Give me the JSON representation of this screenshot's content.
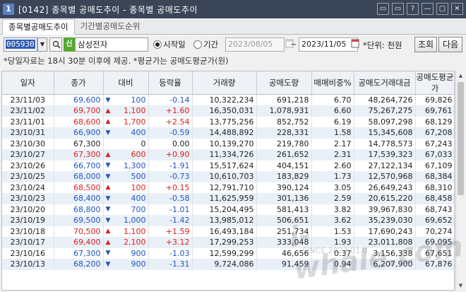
{
  "window": {
    "badge": "1",
    "title": "[0142] 종목별 공매도추이 - 종목별 공매도추이",
    "btns": [
      "▭",
      "▭",
      "?",
      "—",
      "▢",
      "✕"
    ]
  },
  "tabs": [
    {
      "label": "종목별공매도추이"
    },
    {
      "label": "기간별공매도순위"
    }
  ],
  "toolbar": {
    "code": "005930",
    "badge": "신",
    "stock_name": "삼성전자",
    "radio_start": "시작일",
    "radio_period": "기간",
    "date_from": "2023/08/05",
    "tilde": "~",
    "date_to": "2023/11/05",
    "unit": "*단위: 천원",
    "query_btn": "조회",
    "next_btn": "다음"
  },
  "notice": "*당일자료는 18시 30분 이후에 제공. *평균가는 공매도평균가(원)",
  "table": {
    "headers": [
      "일자",
      "종가",
      "대비",
      "등락율",
      "거래량",
      "공매도량",
      "매매비중%",
      "공매도거래대금",
      "공매도평균가"
    ],
    "rows": [
      {
        "date": "23/11/03",
        "close": "69,600",
        "dir": "down",
        "change": "100",
        "rate": "-0.14",
        "volume": "10,322,234",
        "short_vol": "691,218",
        "ratio": "6.70",
        "short_amt": "48,264,726",
        "avg": "69,826"
      },
      {
        "date": "23/11/02",
        "close": "69,700",
        "dir": "up",
        "change": "1,100",
        "rate": "+1.60",
        "volume": "16,350,031",
        "short_vol": "1,078,931",
        "ratio": "6.60",
        "short_amt": "75,267,275",
        "avg": "69,761"
      },
      {
        "date": "23/11/01",
        "close": "68,600",
        "dir": "up",
        "change": "1,700",
        "rate": "+2.54",
        "volume": "13,775,256",
        "short_vol": "852,752",
        "ratio": "6.19",
        "short_amt": "58,097,298",
        "avg": "68,129"
      },
      {
        "date": "23/10/31",
        "close": "66,900",
        "dir": "down",
        "change": "400",
        "rate": "-0.59",
        "volume": "14,488,892",
        "short_vol": "228,331",
        "ratio": "1.58",
        "short_amt": "15,345,608",
        "avg": "67,208"
      },
      {
        "date": "23/10/30",
        "close": "67,300",
        "dir": "flat",
        "change": "0",
        "rate": "0.00",
        "volume": "10,139,270",
        "short_vol": "219,780",
        "ratio": "2.17",
        "short_amt": "14,778,573",
        "avg": "67,243"
      },
      {
        "date": "23/10/27",
        "close": "67,300",
        "dir": "up",
        "change": "600",
        "rate": "+0.90",
        "volume": "11,334,726",
        "short_vol": "261,652",
        "ratio": "2.31",
        "short_amt": "17,539,323",
        "avg": "67,033"
      },
      {
        "date": "23/10/26",
        "close": "66,700",
        "dir": "down",
        "change": "1,300",
        "rate": "-1.91",
        "volume": "15,517,624",
        "short_vol": "404,151",
        "ratio": "2.60",
        "short_amt": "27,122,134",
        "avg": "67,109"
      },
      {
        "date": "23/10/25",
        "close": "68,000",
        "dir": "down",
        "change": "500",
        "rate": "-0.73",
        "volume": "10,610,703",
        "short_vol": "183,829",
        "ratio": "1.73",
        "short_amt": "12,570,968",
        "avg": "68,384"
      },
      {
        "date": "23/10/24",
        "close": "68,500",
        "dir": "up",
        "change": "100",
        "rate": "+0.15",
        "volume": "12,791,710",
        "short_vol": "390,124",
        "ratio": "3.05",
        "short_amt": "26,649,243",
        "avg": "68,310"
      },
      {
        "date": "23/10/23",
        "close": "68,400",
        "dir": "down",
        "change": "400",
        "rate": "-0.58",
        "volume": "11,625,959",
        "short_vol": "301,136",
        "ratio": "2.59",
        "short_amt": "20,615,220",
        "avg": "68,458"
      },
      {
        "date": "23/10/20",
        "close": "68,800",
        "dir": "down",
        "change": "700",
        "rate": "-1.01",
        "volume": "15,204,495",
        "short_vol": "581,413",
        "ratio": "3.82",
        "short_amt": "39,967,830",
        "avg": "68,743"
      },
      {
        "date": "23/10/19",
        "close": "69,500",
        "dir": "down",
        "change": "1,000",
        "rate": "-1.42",
        "volume": "13,985,012",
        "short_vol": "506,651",
        "ratio": "3.62",
        "short_amt": "35,239,030",
        "avg": "69,652"
      },
      {
        "date": "23/10/18",
        "close": "70,500",
        "dir": "up",
        "change": "1,100",
        "rate": "+1.59",
        "volume": "16,493,184",
        "short_vol": "251,734",
        "ratio": "1.53",
        "short_amt": "17,690,243",
        "avg": "70,274"
      },
      {
        "date": "23/10/17",
        "close": "69,400",
        "dir": "up",
        "change": "2,100",
        "rate": "+3.12",
        "volume": "17,299,253",
        "short_vol": "333,048",
        "ratio": "1.93",
        "short_amt": "23,011,808",
        "avg": "69,095"
      },
      {
        "date": "23/10/16",
        "close": "67,300",
        "dir": "down",
        "change": "900",
        "rate": "-1.03",
        "volume": "12,599,299",
        "short_vol": "46,656",
        "ratio": "0.37",
        "short_amt": "3,156,338",
        "avg": "67,651"
      },
      {
        "date": "23/10/13",
        "close": "68,200",
        "dir": "down",
        "change": "900",
        "rate": "-1.31",
        "volume": "9,724,086",
        "short_vol": "91,459",
        "ratio": "0.94",
        "short_amt": "6,207,900",
        "avg": "67,876"
      }
    ]
  },
  "watermark": {
    "text": "i-whale.com",
    "sub": "SINCE 2023.01.0"
  },
  "colors": {
    "up": "#d6221c",
    "down": "#1f55c4",
    "titlebar": "#3a4558",
    "row_alt": "#eaf0f8"
  },
  "icons": {
    "up": "triangle-up",
    "down": "triangle-down",
    "search": "magnifier-icon"
  }
}
